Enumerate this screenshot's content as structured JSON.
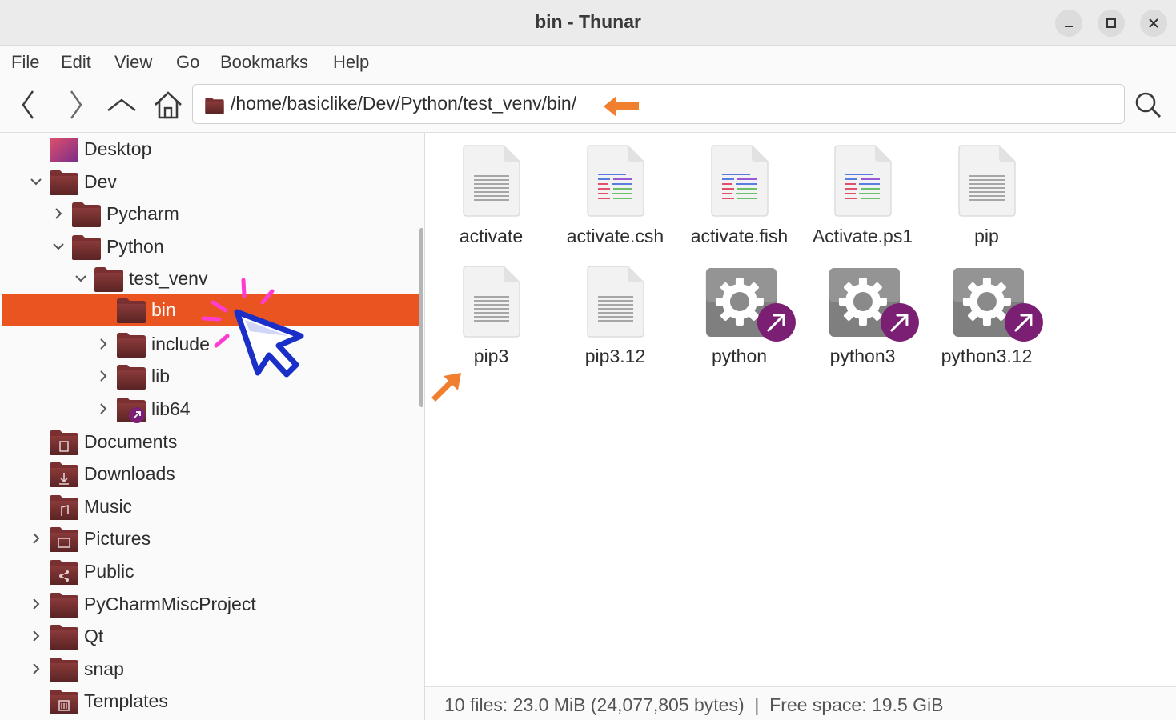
{
  "window": {
    "title": "bin - Thunar"
  },
  "menubar": {
    "items": [
      "File",
      "Edit",
      "View",
      "Go",
      "Bookmarks",
      "Help"
    ]
  },
  "toolbar": {
    "back_icon": "chevron-left-icon",
    "forward_icon": "chevron-right-icon",
    "up_icon": "chevron-up-icon",
    "home_icon": "home-icon",
    "search_icon": "search-icon",
    "path": "/home/basiclike/Dev/Python/test_venv/bin/"
  },
  "sidebar": {
    "items": [
      {
        "label": "Desktop",
        "icon": "desktop-folder-icon"
      },
      {
        "label": "Dev",
        "icon": "folder-icon",
        "expanded": true
      },
      {
        "label": "Pycharm",
        "icon": "folder-icon",
        "expanded": false
      },
      {
        "label": "Python",
        "icon": "folder-icon",
        "expanded": true
      },
      {
        "label": "test_venv",
        "icon": "folder-icon",
        "expanded": true
      },
      {
        "label": "bin",
        "icon": "folder-icon",
        "selected": true
      },
      {
        "label": "include",
        "icon": "folder-icon",
        "expanded": false
      },
      {
        "label": "lib",
        "icon": "folder-icon",
        "expanded": false
      },
      {
        "label": "lib64",
        "icon": "folder-link-icon",
        "expanded": false
      },
      {
        "label": "Documents",
        "icon": "documents-folder-icon"
      },
      {
        "label": "Downloads",
        "icon": "downloads-folder-icon"
      },
      {
        "label": "Music",
        "icon": "music-folder-icon"
      },
      {
        "label": "Pictures",
        "icon": "pictures-folder-icon",
        "expanded": false
      },
      {
        "label": "Public",
        "icon": "public-folder-icon"
      },
      {
        "label": "PyCharmMiscProject",
        "icon": "folder-icon",
        "expanded": false
      },
      {
        "label": "Qt",
        "icon": "folder-icon",
        "expanded": false
      },
      {
        "label": "snap",
        "icon": "folder-icon",
        "expanded": false
      },
      {
        "label": "Templates",
        "icon": "templates-folder-icon"
      }
    ]
  },
  "files": [
    {
      "name": "activate",
      "icon": "text-file-icon"
    },
    {
      "name": "activate.csh",
      "icon": "script-file-icon"
    },
    {
      "name": "activate.fish",
      "icon": "script-file-icon"
    },
    {
      "name": "Activate.ps1",
      "icon": "script-file-icon"
    },
    {
      "name": "pip",
      "icon": "text-file-icon"
    },
    {
      "name": "pip3",
      "icon": "text-file-icon"
    },
    {
      "name": "pip3.12",
      "icon": "text-file-icon"
    },
    {
      "name": "python",
      "icon": "executable-link-icon"
    },
    {
      "name": "python3",
      "icon": "executable-link-icon"
    },
    {
      "name": "python3.12",
      "icon": "executable-link-icon"
    }
  ],
  "statusbar": {
    "text": "10 files: 23.0 MiB (24,077,805 bytes)  |  Free space: 19.5 GiB"
  },
  "colors": {
    "selection": "#e95420",
    "annotation_arrow": "#f07f2f",
    "cursor_outline": "#1a2ec8",
    "spark": "#ff3cd2",
    "link_badge": "#7b1f74"
  }
}
